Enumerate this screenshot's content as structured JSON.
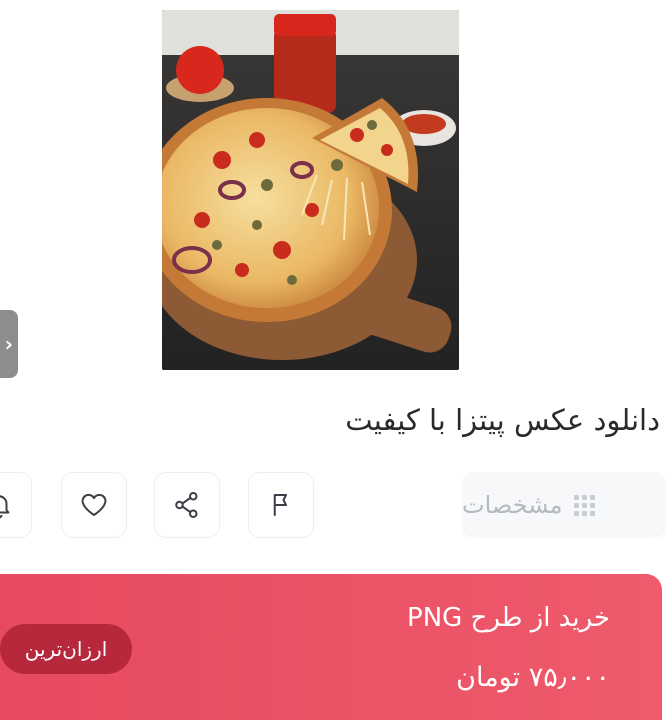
{
  "product": {
    "title": "دانلود عکس پیتزا با کیفیت"
  },
  "tabs": {
    "specs_label": "مشخصات"
  },
  "actions": {
    "report_icon": "flag-icon",
    "share_icon": "share-icon",
    "like_icon": "heart-icon",
    "notify_icon": "bell-icon"
  },
  "purchase": {
    "heading": "خرید از طرح PNG",
    "price": "۷۵٫۰۰۰ تومان",
    "badge": "ارزان‌ترین"
  },
  "colors": {
    "accent": "#e64a60",
    "badge": "#b8283d"
  }
}
